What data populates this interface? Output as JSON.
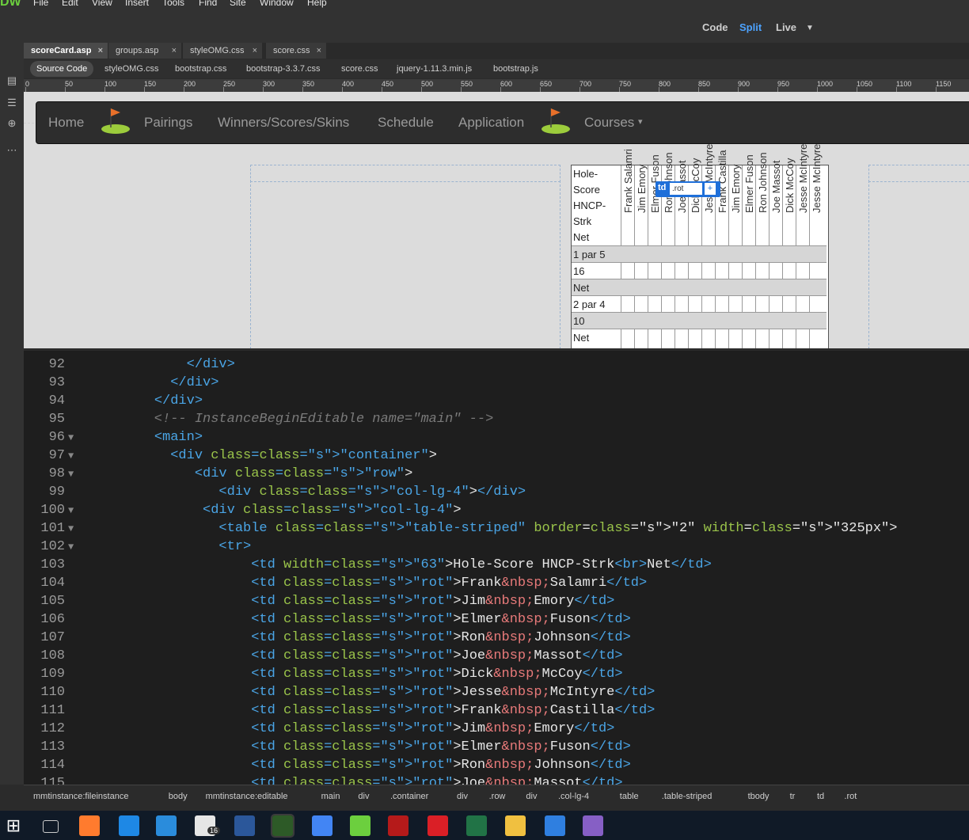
{
  "app": {
    "logo": "DW",
    "menu": [
      "File",
      "Edit",
      "View",
      "Insert",
      "Tools",
      "Find",
      "Site",
      "Window",
      "Help"
    ],
    "views": [
      "Code",
      "Split",
      "Live"
    ],
    "active_view": "Split"
  },
  "doc_tabs": [
    {
      "label": "scoreCard.asp",
      "active": true
    },
    {
      "label": "groups.asp",
      "active": false
    },
    {
      "label": "styleOMG.css",
      "active": false
    },
    {
      "label": "score.css",
      "active": false
    }
  ],
  "related_files": [
    "Source Code",
    "styleOMG.css",
    "bootstrap.css",
    "bootstrap-3.3.7.css",
    "score.css",
    "jquery-1.11.3.min.js",
    "bootstrap.js"
  ],
  "ruler_labels": [
    "0",
    "50",
    "100",
    "150",
    "200",
    "250",
    "300",
    "350",
    "400",
    "450",
    "500",
    "550",
    "600",
    "650",
    "700",
    "750",
    "800",
    "850",
    "900",
    "950",
    "1000",
    "1050",
    "1100",
    "1150"
  ],
  "nav": {
    "links": [
      "Home",
      "Pairings",
      "Winners/Scores/Skins",
      "Schedule",
      "Application",
      "Courses"
    ],
    "courses_caret": "▾"
  },
  "scorecard": {
    "header_lines": [
      "Hole-",
      "Score",
      "HNCP-",
      "Strk",
      "Net"
    ],
    "players": [
      "Frank Salamri",
      "Jim Emory",
      "Elmer Fuson",
      "Ron Johnson",
      "Joe Massot",
      "Dick McCoy",
      "Jesse McIntyre",
      "Frank Castilla",
      "Jim Emory",
      "Elmer Fuson",
      "Ron Johnson",
      "Joe Massot",
      "Dick McCoy",
      "Jesse McIntyre",
      "Jesse McIntyre"
    ],
    "rows": [
      "1 par 5",
      "16",
      "Net",
      "2 par 4",
      "10",
      "Net"
    ],
    "badge_tag": "td",
    "badge_class": ".rot",
    "badge_plus": "+"
  },
  "code": {
    "lines": [
      {
        "n": "92",
        "fold": "",
        "html": "        </div>"
      },
      {
        "n": "93",
        "fold": "",
        "html": "      </div>"
      },
      {
        "n": "94",
        "fold": "",
        "html": "    </div>"
      },
      {
        "n": "95",
        "fold": "",
        "html": "    <!-- InstanceBeginEditable name=\"main\" -->"
      },
      {
        "n": "96",
        "fold": "▼",
        "html": "    <main>"
      },
      {
        "n": "97",
        "fold": "▼",
        "html": "      <div class=\"container\">"
      },
      {
        "n": "98",
        "fold": "▼",
        "html": "         <div class=\"row\">"
      },
      {
        "n": "99",
        "fold": "",
        "html": "            <div class=\"col-lg-4\"></div>"
      },
      {
        "n": "100",
        "fold": "▼",
        "html": "          <div class=\"col-lg-4\">"
      },
      {
        "n": "101",
        "fold": "▼",
        "html": "            <table class=\"table-striped\" border=\"2\" width=\"325px\">"
      },
      {
        "n": "102",
        "fold": "▼",
        "html": "            <tr>"
      },
      {
        "n": "103",
        "fold": "",
        "html": "                <td width=\"63\">Hole-Score HNCP-Strk<br>Net</td>"
      },
      {
        "n": "104",
        "fold": "",
        "html": "                <td class=\"rot\">Frank&nbsp;Salamri</td>"
      },
      {
        "n": "105",
        "fold": "",
        "html": "                <td class=\"rot\">Jim&nbsp;Emory</td>"
      },
      {
        "n": "106",
        "fold": "",
        "html": "                <td class=\"rot\">Elmer&nbsp;Fuson</td>"
      },
      {
        "n": "107",
        "fold": "",
        "html": "                <td class=\"rot\">Ron&nbsp;Johnson</td>"
      },
      {
        "n": "108",
        "fold": "",
        "html": "                <td class=\"rot\">Joe&nbsp;Massot</td>"
      },
      {
        "n": "109",
        "fold": "",
        "html": "                <td class=\"rot\">Dick&nbsp;McCoy</td>"
      },
      {
        "n": "110",
        "fold": "",
        "html": "                <td class=\"rot\">Jesse&nbsp;McIntyre</td>"
      },
      {
        "n": "111",
        "fold": "",
        "html": "                <td class=\"rot\">Frank&nbsp;Castilla</td>"
      },
      {
        "n": "112",
        "fold": "",
        "html": "                <td class=\"rot\">Jim&nbsp;Emory</td>"
      },
      {
        "n": "113",
        "fold": "",
        "html": "                <td class=\"rot\">Elmer&nbsp;Fuson</td>"
      },
      {
        "n": "114",
        "fold": "",
        "html": "                <td class=\"rot\">Ron&nbsp;Johnson</td>"
      },
      {
        "n": "115",
        "fold": "",
        "html": "                <td class=\"rot\">Joe&nbsp;Massot</td>"
      }
    ]
  },
  "tag_selector": [
    "mmtinstance:fileinstance",
    "body",
    "mmtinstance:editable",
    "main",
    "div",
    ".container",
    "div",
    ".row",
    "div",
    ".col-lg-4",
    "table",
    ".table-striped",
    "tbody",
    "tr",
    "td",
    ".rot"
  ],
  "taskbar": {
    "mail_badge": "16",
    "icons": [
      "windows-start-icon",
      "task-view-icon",
      "firefox-icon",
      "edge-icon",
      "store-icon",
      "mail-icon",
      "word-icon",
      "dreamweaver-icon",
      "chrome-icon",
      "image-viewer-icon",
      "filezilla-icon",
      "creative-cloud-icon",
      "excel-icon",
      "file-explorer-icon",
      "firefox-dev-icon",
      "visual-studio-icon"
    ]
  },
  "colors": {
    "accent": "#4da3ff",
    "dw_green": "#6ccf3e",
    "badge_blue": "#1e6fd9"
  }
}
